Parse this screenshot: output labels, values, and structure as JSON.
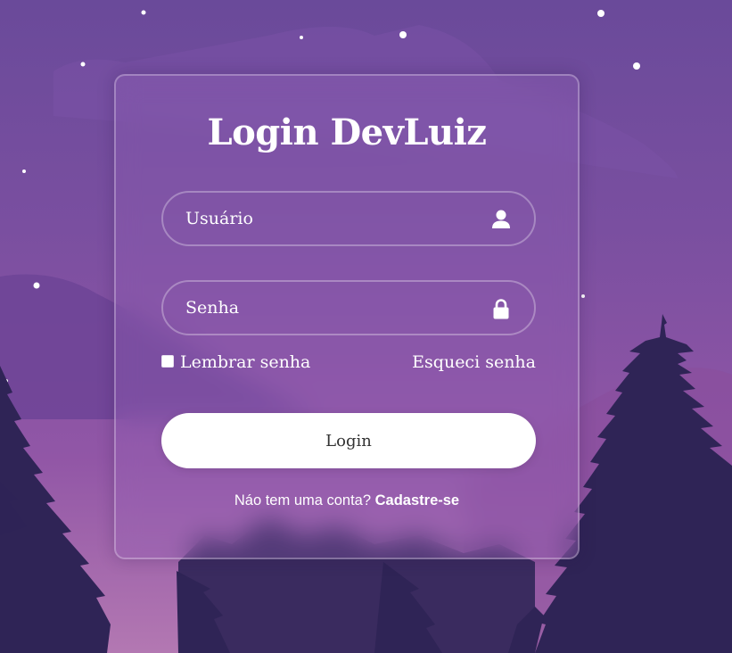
{
  "colors": {
    "background_top": "#6a4a9a",
    "background_bottom": "#b378b2",
    "trees": "#2f2456",
    "button_background": "#ffffff",
    "button_text": "#333333",
    "text": "#ffffff"
  },
  "login_form": {
    "title": "Login DevLuiz",
    "username": {
      "placeholder": "Usuário",
      "value": "",
      "icon": "user-icon"
    },
    "password": {
      "placeholder": "Senha",
      "value": "",
      "icon": "lock-icon"
    },
    "remember_label": "Lembrar senha",
    "remember_checked": false,
    "forgot_label": "Esqueci senha",
    "submit_label": "Login",
    "signup_prompt": "Náo tem uma conta?",
    "signup_link": "Cadastre-se"
  }
}
